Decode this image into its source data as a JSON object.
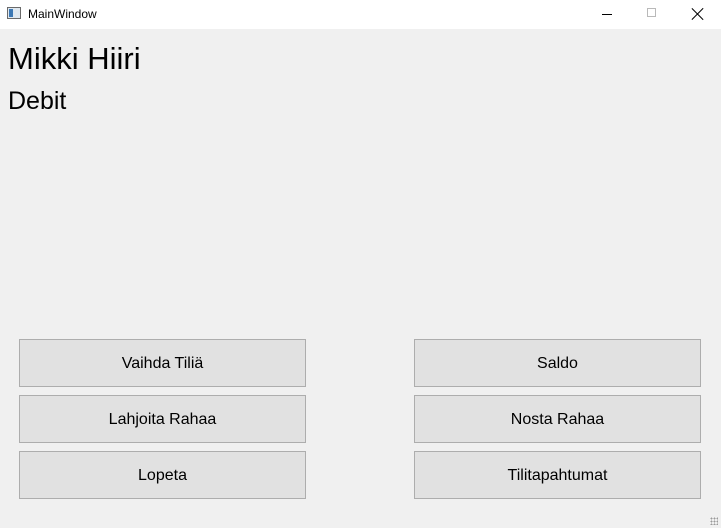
{
  "window": {
    "title": "MainWindow"
  },
  "account": {
    "holder_name": "Mikki Hiiri",
    "account_type": "Debit"
  },
  "buttons": {
    "change_account": "Vaihda Tiliä",
    "balance": "Saldo",
    "donate_money": "Lahjoita Rahaa",
    "withdraw_money": "Nosta Rahaa",
    "quit": "Lopeta",
    "transactions": "Tilitapahtumat"
  }
}
